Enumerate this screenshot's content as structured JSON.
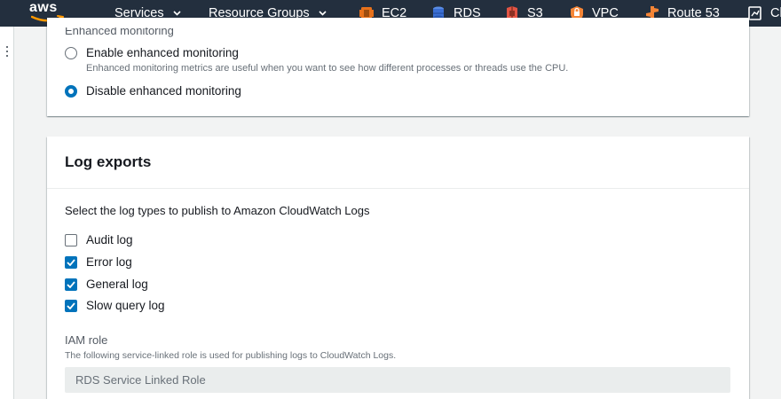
{
  "nav": {
    "logo": "aws",
    "services": "Services",
    "resource_groups": "Resource Groups",
    "shortcuts": [
      {
        "label": "EC2",
        "icon": "ec2-icon",
        "color": "#e7711b"
      },
      {
        "label": "RDS",
        "icon": "rds-icon",
        "color": "#3b6fd4"
      },
      {
        "label": "S3",
        "icon": "s3-icon",
        "color": "#e25444"
      },
      {
        "label": "VPC",
        "icon": "vpc-icon",
        "color": "#f58536"
      },
      {
        "label": "Route 53",
        "icon": "route53-icon",
        "color": "#f58536"
      },
      {
        "label": "Cl",
        "icon": "cloudwatch-icon",
        "color": "#ffffff"
      }
    ]
  },
  "monitoring": {
    "section_label": "Enhanced monitoring",
    "enable_label": "Enable enhanced monitoring",
    "enable_desc": "Enhanced monitoring metrics are useful when you want to see how different processes or threads use the CPU.",
    "disable_label": "Disable enhanced monitoring",
    "selected": "disable"
  },
  "log_exports": {
    "title": "Log exports",
    "intro": "Select the log types to publish to Amazon CloudWatch Logs",
    "items": [
      {
        "label": "Audit log",
        "checked": false
      },
      {
        "label": "Error log",
        "checked": true
      },
      {
        "label": "General log",
        "checked": true
      },
      {
        "label": "Slow query log",
        "checked": true
      }
    ],
    "iam_label": "IAM role",
    "iam_desc": "The following service-linked role is used for publishing logs to CloudWatch Logs.",
    "iam_value": "RDS Service Linked Role"
  },
  "colors": {
    "nav_bg": "#232f3e",
    "accent": "#0073bb"
  }
}
